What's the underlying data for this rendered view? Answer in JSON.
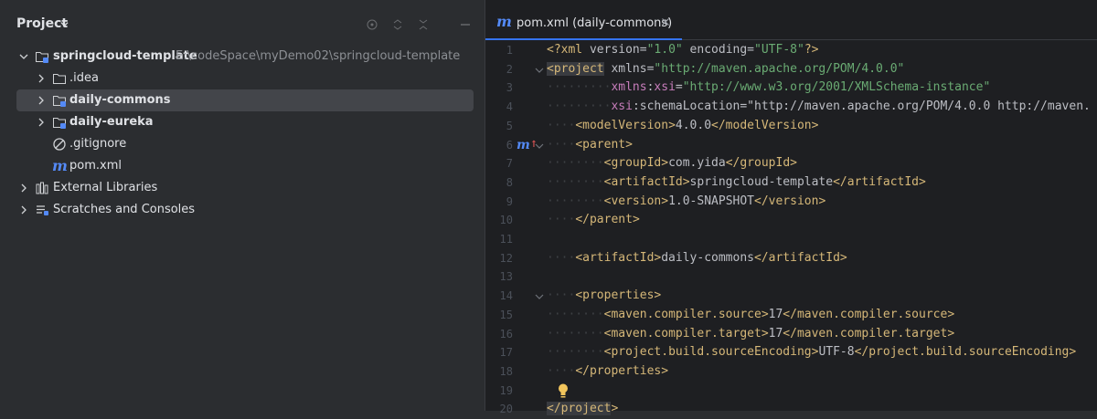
{
  "panel": {
    "title": "Project",
    "tree": [
      {
        "label": "springcloud-template",
        "path": "E:\\codeSpace\\myDemo02\\springcloud-template",
        "icon": "module-folder-icon",
        "expanded": true,
        "bold": true
      },
      {
        "label": ".idea",
        "icon": "folder-icon",
        "expanded": false
      },
      {
        "label": "daily-commons",
        "icon": "module-folder-icon",
        "expanded": false,
        "bold": true,
        "selected": true
      },
      {
        "label": "daily-eureka",
        "icon": "module-folder-icon",
        "expanded": false,
        "bold": true
      },
      {
        "label": ".gitignore",
        "icon": "ignore-file-icon"
      },
      {
        "label": "pom.xml",
        "icon": "maven-icon"
      },
      {
        "label": "External Libraries",
        "icon": "library-icon",
        "expanded": false
      },
      {
        "label": "Scratches and Consoles",
        "icon": "scratches-icon",
        "expanded": false
      }
    ]
  },
  "editor": {
    "tab": {
      "label": "pom.xml (daily-commons)",
      "icon": "maven-icon"
    },
    "lines": [
      {
        "n": "1",
        "text": "<?xml version=\"1.0\" encoding=\"UTF-8\"?>"
      },
      {
        "n": "2",
        "text": "<project xmlns=\"http://maven.apache.org/POM/4.0.0\""
      },
      {
        "n": "3",
        "text": "xmlns:xsi=\"http://www.w3.org/2001/XMLSchema-instance\""
      },
      {
        "n": "4",
        "text": "xsi:schemaLocation=\"http://maven.apache.org/POM/4.0.0 http://maven."
      },
      {
        "n": "5",
        "text": "<modelVersion>4.0.0</modelVersion>"
      },
      {
        "n": "6",
        "text": "<parent>"
      },
      {
        "n": "7",
        "text": "<groupId>com.yida</groupId>"
      },
      {
        "n": "8",
        "text": "<artifactId>springcloud-template</artifactId>"
      },
      {
        "n": "9",
        "text": "<version>1.0-SNAPSHOT</version>"
      },
      {
        "n": "10",
        "text": "</parent>"
      },
      {
        "n": "11",
        "text": ""
      },
      {
        "n": "12",
        "text": "<artifactId>daily-commons</artifactId>"
      },
      {
        "n": "13",
        "text": ""
      },
      {
        "n": "14",
        "text": "<properties>"
      },
      {
        "n": "15",
        "text": "<maven.compiler.source>17</maven.compiler.source>"
      },
      {
        "n": "16",
        "text": "<maven.compiler.target>17</maven.compiler.target>"
      },
      {
        "n": "17",
        "text": "<project.build.sourceEncoding>UTF-8</project.build.sourceEncoding>"
      },
      {
        "n": "18",
        "text": "</properties>"
      },
      {
        "n": "19",
        "text": ""
      },
      {
        "n": "20",
        "text": "</project>"
      }
    ]
  },
  "colors": {
    "accent": "#3574f0",
    "maven": "#548af7",
    "tag": "#d5b778",
    "string": "#6aab73"
  }
}
